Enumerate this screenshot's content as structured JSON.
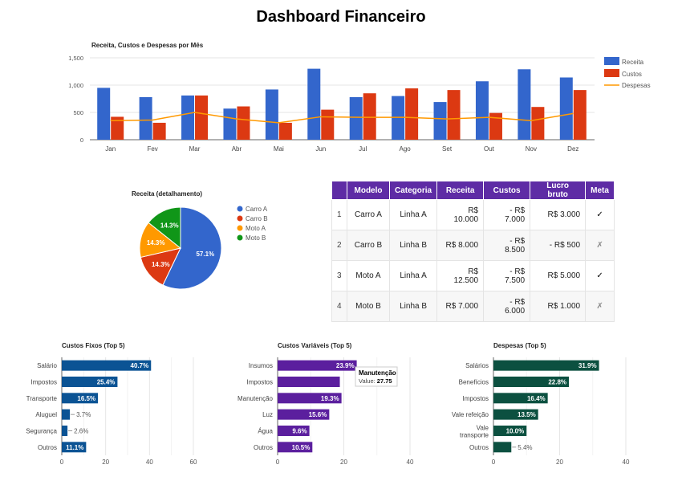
{
  "page": {
    "title": "Dashboard Financeiro"
  },
  "colors": {
    "receita": "#3366cc",
    "custos": "#dc3912",
    "despesas": "#ff9900",
    "carroB": "#dc3912",
    "motoB": "#109618",
    "fixos": "#0b5394",
    "variaveis": "#5b1f9e",
    "despesasBar": "#0c5040",
    "table_header": "#5e2ca5"
  },
  "chart_data": [
    {
      "type": "bar",
      "title": "Receita, Custos e Despesas por Mês",
      "categories": [
        "Jan",
        "Fev",
        "Mar",
        "Abr",
        "Mai",
        "Jun",
        "Jul",
        "Ago",
        "Set",
        "Out",
        "Nov",
        "Dez"
      ],
      "series": [
        {
          "name": "Receita",
          "type": "bar",
          "values": [
            950,
            780,
            810,
            570,
            920,
            1300,
            780,
            800,
            690,
            1070,
            1290,
            1140
          ]
        },
        {
          "name": "Custos",
          "type": "bar",
          "values": [
            420,
            310,
            810,
            610,
            310,
            550,
            850,
            940,
            910,
            490,
            600,
            910
          ]
        },
        {
          "name": "Despesas",
          "type": "line",
          "values": [
            350,
            360,
            500,
            380,
            310,
            420,
            410,
            410,
            380,
            410,
            350,
            480
          ]
        }
      ],
      "yticks": [
        "0",
        "500",
        "1,000",
        "1,500"
      ],
      "ylim": [
        0,
        1500
      ],
      "legend_position": "right",
      "grid": true
    },
    {
      "type": "pie",
      "title": "Receita (detalhamento)",
      "labels": [
        "Carro A",
        "Carro B",
        "Moto A",
        "Moto B"
      ],
      "values": [
        57.1,
        14.3,
        14.3,
        14.3
      ],
      "value_labels": [
        "57.1%",
        "14.3%",
        "14.3%",
        "14.3%"
      ],
      "legend_position": "right"
    },
    {
      "type": "bar",
      "orientation": "horizontal",
      "title": "Custos Fixos (Top 5)",
      "categories": [
        "Salário",
        "Impostos",
        "Transporte",
        "Aluguel",
        "Segurança",
        "Outros"
      ],
      "values": [
        40.7,
        25.4,
        16.5,
        3.7,
        2.6,
        11.1
      ],
      "value_labels": [
        "40.7%",
        "25.4%",
        "16.5%",
        "3.7%",
        "2.6%",
        "11.1%"
      ],
      "xticks": [
        "0",
        "20",
        "40",
        "60"
      ],
      "xlim": [
        0,
        60
      ]
    },
    {
      "type": "bar",
      "orientation": "horizontal",
      "title": "Custos Variáveis (Top 5)",
      "categories": [
        "Insumos",
        "Impostos",
        "Manutenção",
        "Luz",
        "Água",
        "Outros"
      ],
      "values": [
        23.9,
        18.8,
        19.3,
        15.6,
        9.6,
        10.5
      ],
      "value_labels": [
        "23.9%",
        "",
        "19.3%",
        "15.6%",
        "9.6%",
        "10.5%"
      ],
      "xticks": [
        "0",
        "20",
        "40"
      ],
      "xlim": [
        0,
        40
      ],
      "tooltip": {
        "title": "Manutenção",
        "label": "Value:",
        "value": "27.75"
      }
    },
    {
      "type": "bar",
      "orientation": "horizontal",
      "title": "Despesas (Top 5)",
      "categories": [
        "Salários",
        "Benefícios",
        "Impostos",
        "Vale refeição",
        "Vale\ntransporte",
        "Outros"
      ],
      "values": [
        31.9,
        22.8,
        16.4,
        13.5,
        10.0,
        5.4
      ],
      "value_labels": [
        "31.9%",
        "22.8%",
        "16.4%",
        "13.5%",
        "10.0%",
        "5.4%"
      ],
      "xticks": [
        "0",
        "20",
        "40"
      ],
      "xlim": [
        0,
        40
      ]
    }
  ],
  "table": {
    "headers": [
      "",
      "Modelo",
      "Categoria",
      "Receita",
      "Custos",
      "Lucro bruto",
      "Meta"
    ],
    "rows": [
      [
        "1",
        "Carro A",
        "Linha A",
        "R$ 10.000",
        "- R$ 7.000",
        "R$ 3.000",
        "✓"
      ],
      [
        "2",
        "Carro B",
        "Linha B",
        "R$ 8.000",
        "- R$ 8.500",
        "- R$ 500",
        "✗"
      ],
      [
        "3",
        "Moto A",
        "Linha A",
        "R$ 12.500",
        "- R$ 7.500",
        "R$ 5.000",
        "✓"
      ],
      [
        "4",
        "Moto B",
        "Linha B",
        "R$ 7.000",
        "- R$ 6.000",
        "R$ 1.000",
        "✗"
      ]
    ]
  }
}
